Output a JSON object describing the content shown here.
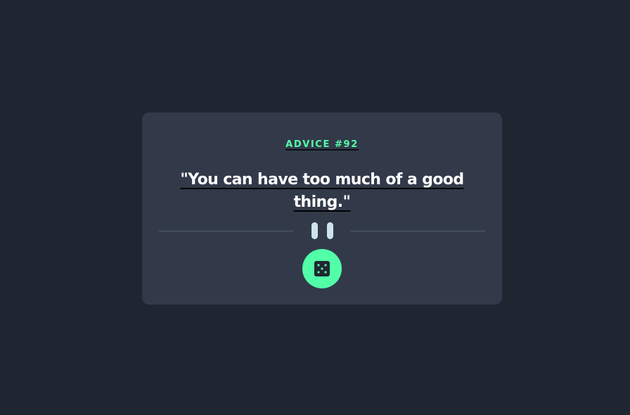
{
  "advice": {
    "id_label": "ADVICE #92",
    "quote": "\"You can have too much of a good thing.\""
  },
  "colors": {
    "background": "#1f2531",
    "card": "#323a4a",
    "accent": "#52ffa8",
    "quote_text": "#ffffff",
    "divider": "#4f5d74",
    "pause_icon": "#cee3e9"
  },
  "icons": {
    "divider": "pause-icon",
    "button": "dice-icon"
  }
}
